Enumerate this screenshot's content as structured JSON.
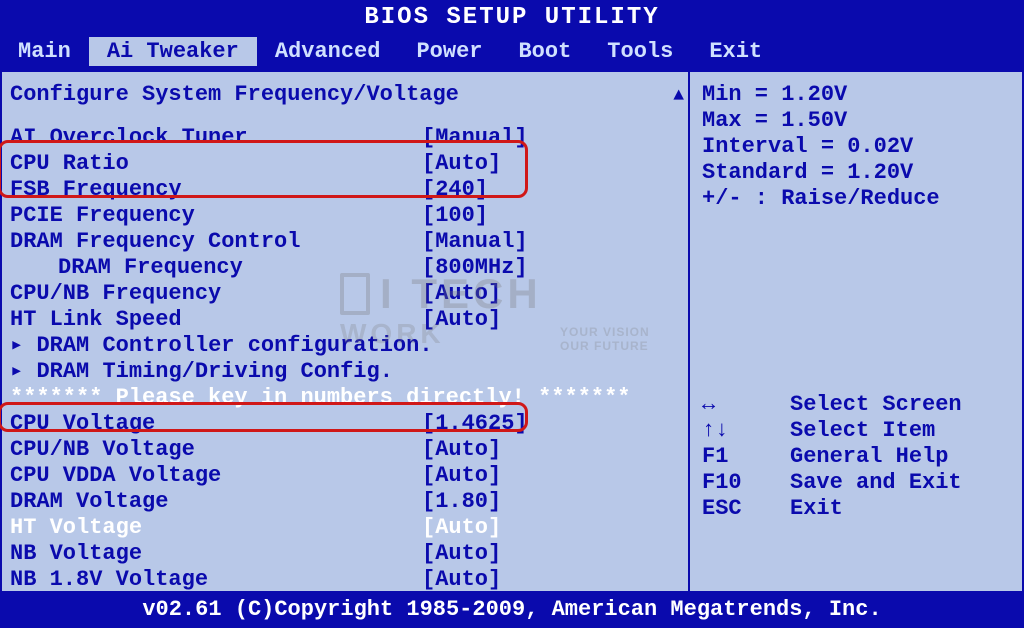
{
  "title": "BIOS SETUP UTILITY",
  "menu": {
    "items": [
      "Main",
      "Ai Tweaker",
      "Advanced",
      "Power",
      "Boot",
      "Tools",
      "Exit"
    ],
    "active_index": 1
  },
  "section_title": "Configure System Frequency/Voltage",
  "settings": [
    {
      "label": "AI Overclock Tuner",
      "value": "[Manual]",
      "highlight": false
    },
    {
      "label": "CPU Ratio",
      "value": "[Auto]",
      "highlight": false
    },
    {
      "label": "FSB Frequency",
      "value": "[240]",
      "highlight": false
    },
    {
      "label": "PCIE Frequency",
      "value": "[100]",
      "highlight": false
    },
    {
      "label": "DRAM Frequency Control",
      "value": "[Manual]",
      "highlight": false
    },
    {
      "label": "DRAM Frequency",
      "value": "[800MHz]",
      "highlight": false,
      "indent": true
    },
    {
      "label": "CPU/NB Frequency",
      "value": "[Auto]",
      "highlight": false
    },
    {
      "label": "HT Link Speed",
      "value": "[Auto]",
      "highlight": false
    },
    {
      "label": "DRAM Controller configuration.",
      "value": "",
      "submenu": true
    },
    {
      "label": "DRAM Timing/Driving Config.",
      "value": "",
      "submenu": true
    },
    {
      "label": "CPU Voltage",
      "value": "[1.4625]",
      "highlight": false
    },
    {
      "label": "CPU/NB Voltage",
      "value": "[Auto]",
      "highlight": false
    },
    {
      "label": "CPU VDDA Voltage",
      "value": "[Auto]",
      "highlight": false
    },
    {
      "label": "DRAM Voltage",
      "value": "[1.80]",
      "highlight": false
    },
    {
      "label": "HT Voltage",
      "value": "[Auto]",
      "highlight": true
    },
    {
      "label": "NB Voltage",
      "value": "[Auto]",
      "highlight": false
    },
    {
      "label": "NB 1.8V Voltage",
      "value": "[Auto]",
      "highlight": false
    }
  ],
  "separator": "******* Please key in numbers directly! *******",
  "info": {
    "min": "Min = 1.20V",
    "max": "Max = 1.50V",
    "interval": "Interval = 0.02V",
    "standard": "Standard = 1.20V",
    "raise": "+/- : Raise/Reduce"
  },
  "help": [
    {
      "key": "↔",
      "text": "Select Screen"
    },
    {
      "key": "↑↓",
      "text": "Select Item"
    },
    {
      "key": "F1",
      "text": "General Help"
    },
    {
      "key": "F10",
      "text": "Save and Exit"
    },
    {
      "key": "ESC",
      "text": "Exit"
    }
  ],
  "footer": "v02.61 (C)Copyright 1985-2009, American Megatrends, Inc.",
  "watermark": {
    "main": "I TECH",
    "sub": "WORK",
    "tag1": "YOUR VISION",
    "tag2": "OUR FUTURE"
  }
}
